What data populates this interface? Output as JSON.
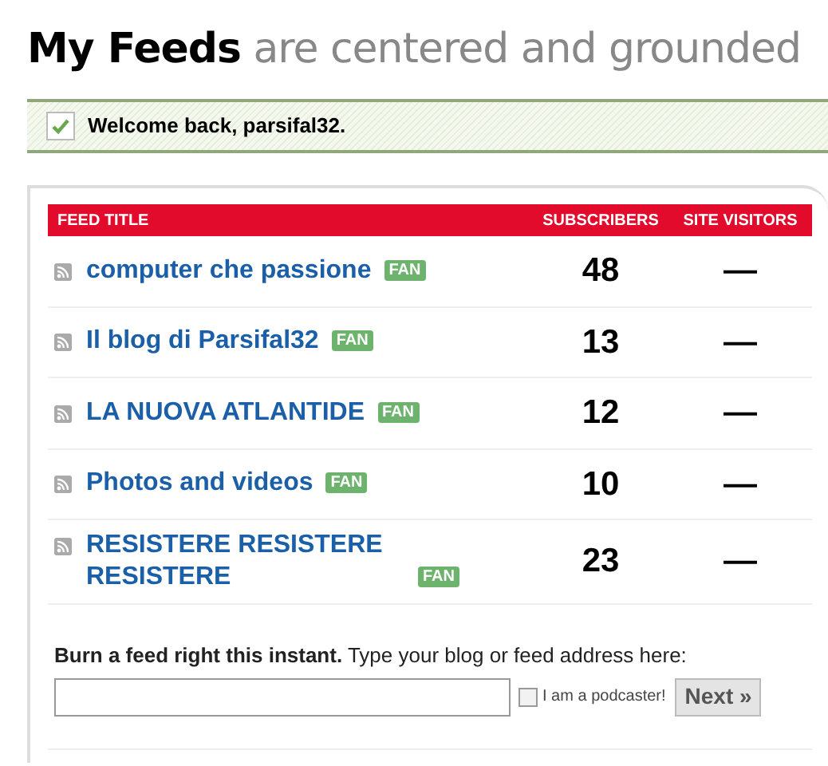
{
  "heading": {
    "main": "My Feeds",
    "sub": "are centered and grounded"
  },
  "notice": {
    "text": "Welcome back, parsifal32."
  },
  "table": {
    "columns": [
      "FEED TITLE",
      "SUBSCRIBERS",
      "SITE VISITORS"
    ],
    "rows": [
      {
        "title": "computer che passione",
        "badge": "FAN",
        "subscribers": "48",
        "visitors": "—"
      },
      {
        "title": "Il blog di Parsifal32",
        "badge": "FAN",
        "subscribers": "13",
        "visitors": "—"
      },
      {
        "title": "LA NUOVA ATLANTIDE",
        "badge": "FAN",
        "subscribers": "12",
        "visitors": "—"
      },
      {
        "title": "Photos and videos",
        "badge": "FAN",
        "subscribers": "10",
        "visitors": "—"
      },
      {
        "title": "RESISTERE RESISTERE RESISTERE",
        "badge": "FAN",
        "subscribers": "23",
        "visitors": "—"
      }
    ]
  },
  "burn_form": {
    "prompt": "**Burn a feed right this instant.** Type your blog or feed address here:",
    "podcaster": {
      "label": "I am a podcaster!",
      "checked": false
    },
    "button": "Next »"
  }
}
